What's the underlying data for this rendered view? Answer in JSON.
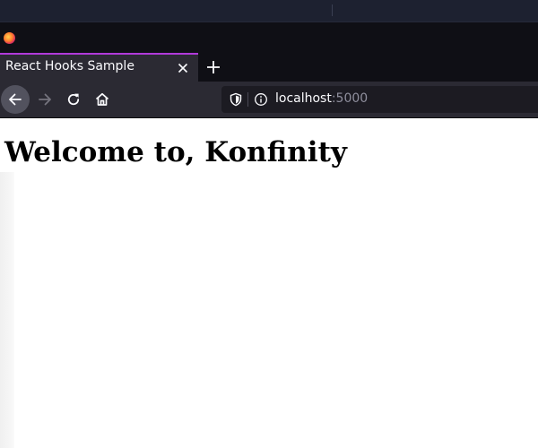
{
  "browser": {
    "tab": {
      "title": "React Hooks Sample"
    },
    "url": {
      "host": "localhost",
      "port": ":5000"
    },
    "colors": {
      "tab_accent": "#b03ad9",
      "chrome_dark": "#0f0f15",
      "toolbar": "#2b2a33"
    }
  },
  "icons": {
    "pinned": "firefox-logo",
    "tab_close": "close-icon",
    "new_tab": "plus-icon",
    "back": "arrow-left-icon",
    "forward": "arrow-right-icon",
    "reload": "reload-icon",
    "home": "home-icon",
    "security": "shield-icon",
    "info": "info-icon"
  },
  "page": {
    "heading": "Welcome to, Konfinity"
  }
}
